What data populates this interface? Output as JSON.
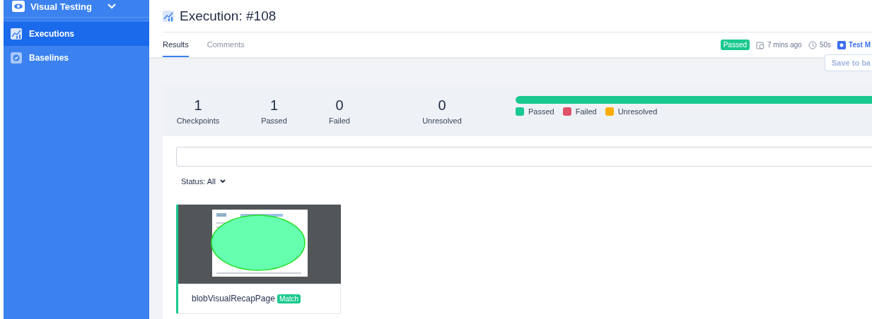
{
  "sidebar": {
    "title": "Visual Testing",
    "items": [
      {
        "label": "Executions",
        "selected": true
      },
      {
        "label": "Baselines",
        "selected": false
      }
    ]
  },
  "header": {
    "title": "Execution: #108",
    "status": "Passed",
    "age": "7 mins ago",
    "duration": "50s",
    "suite": "Test M"
  },
  "tabs": [
    {
      "label": "Results",
      "selected": true
    },
    {
      "label": "Comments",
      "selected": false
    }
  ],
  "save_button": {
    "label": "Save to ba",
    "disabled": true
  },
  "stats": [
    {
      "value": "1",
      "label": "Checkpoints"
    },
    {
      "value": "1",
      "label": "Passed"
    },
    {
      "value": "0",
      "label": "Failed"
    },
    {
      "value": "0",
      "label": "Unresolved"
    }
  ],
  "progress": {
    "level": 1
  },
  "legend": [
    {
      "label": "Passed",
      "color": "#19c98f"
    },
    {
      "label": "Failed",
      "color": "#e0516a"
    },
    {
      "label": "Unresolved",
      "color": "#fbac00"
    }
  ],
  "filter": {
    "label": "Status: All"
  },
  "cards": [
    {
      "name": "blobVisualRecapPage",
      "badge": "Match",
      "kind": "picture"
    }
  ]
}
